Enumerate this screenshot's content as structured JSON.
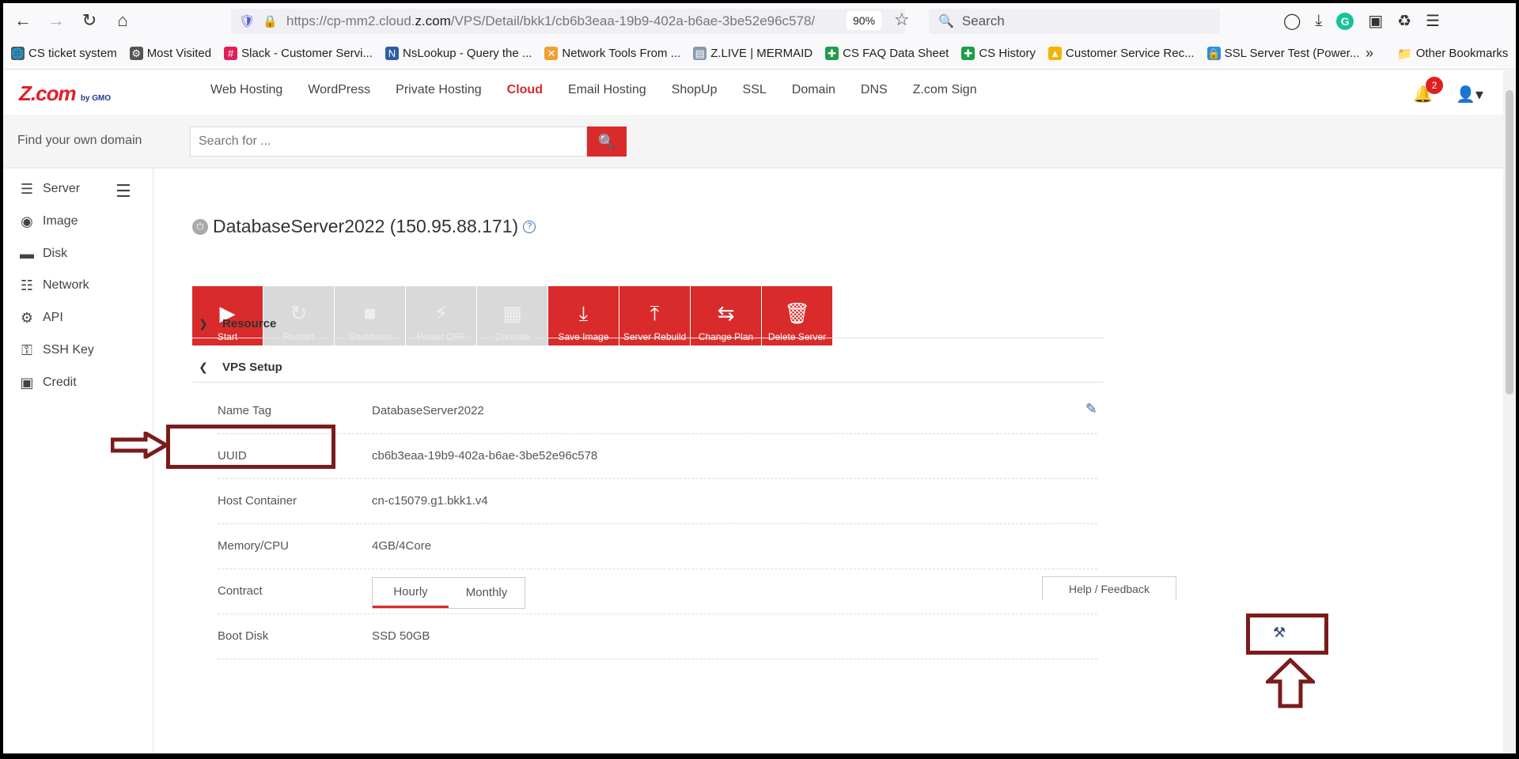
{
  "browser": {
    "url_prefix": "https://cp-mm2.cloud.",
    "url_domain": "z.com",
    "url_path": "/VPS/Detail/bkk1/cb6b3eaa-19b9-402a-b6ae-3be52e96c578/",
    "zoom": "90%",
    "search_placeholder": "Search",
    "bookmarks": [
      {
        "label": "CS ticket system",
        "icon": "globe-icon",
        "color": "#555555"
      },
      {
        "label": "Most Visited",
        "icon": "gear-icon",
        "color": "#555555"
      },
      {
        "label": "Slack - Customer Servi...",
        "icon": "slack-icon",
        "color": "#e01e5a"
      },
      {
        "label": "NsLookup - Query the ...",
        "icon": "nslookup-icon",
        "color": "#2b5ea7"
      },
      {
        "label": "Network Tools From ...",
        "icon": "network-tools-icon",
        "color": "#f0a030"
      },
      {
        "label": "Z.LIVE | MERMAID",
        "icon": "doc-icon",
        "color": "#8899aa"
      },
      {
        "label": "CS FAQ Data Sheet",
        "icon": "sheets-icon",
        "color": "#1e9e4a"
      },
      {
        "label": "CS History",
        "icon": "sheets-icon",
        "color": "#1e9e4a"
      },
      {
        "label": "Customer Service Rec...",
        "icon": "drive-icon",
        "color": "#f4b400"
      },
      {
        "label": "SSL Server Test (Power...",
        "icon": "lock-icon",
        "color": "#2a8ee0"
      }
    ],
    "bookmarks_more": "»",
    "other_bookmarks": "Other Bookmarks"
  },
  "header": {
    "logo_main": "Z.com",
    "logo_sub": "by GMO",
    "nav": [
      {
        "label": "Web Hosting",
        "active": false
      },
      {
        "label": "WordPress",
        "active": false
      },
      {
        "label": "Private Hosting",
        "active": false
      },
      {
        "label": "Cloud",
        "active": true
      },
      {
        "label": "Email Hosting",
        "active": false
      },
      {
        "label": "ShopUp",
        "active": false
      },
      {
        "label": "SSL",
        "active": false
      },
      {
        "label": "Domain",
        "active": false
      },
      {
        "label": "DNS",
        "active": false
      },
      {
        "label": "Z.com Sign",
        "active": false
      }
    ],
    "notification_count": "2"
  },
  "domain_search": {
    "label": "Find your own domain",
    "placeholder": "Search for ..."
  },
  "sidebar": {
    "items": [
      {
        "label": "Server",
        "icon": "server-icon"
      },
      {
        "label": "Image",
        "icon": "image-disc-icon"
      },
      {
        "label": "Disk",
        "icon": "disk-icon"
      },
      {
        "label": "Network",
        "icon": "network-icon"
      },
      {
        "label": "API",
        "icon": "api-icon"
      },
      {
        "label": "SSH Key",
        "icon": "key-icon"
      },
      {
        "label": "Credit",
        "icon": "credit-card-icon"
      }
    ]
  },
  "server": {
    "title": "DatabaseServer2022 (150.95.88.171)",
    "actions": [
      {
        "label": "Start",
        "enabled": true,
        "icon": "play-icon"
      },
      {
        "label": "Restart",
        "enabled": false,
        "icon": "restart-icon"
      },
      {
        "label": "Shutdown",
        "enabled": false,
        "icon": "stop-icon"
      },
      {
        "label": "Power OFF",
        "enabled": false,
        "icon": "plug-icon"
      },
      {
        "label": "Console",
        "enabled": false,
        "icon": "console-icon"
      },
      {
        "label": "Save Image",
        "enabled": true,
        "icon": "save-image-icon"
      },
      {
        "label": "Server Rebuild",
        "enabled": true,
        "icon": "rebuild-icon"
      },
      {
        "label": "Change Plan",
        "enabled": true,
        "icon": "swap-icon"
      },
      {
        "label": "Delete Server",
        "enabled": true,
        "icon": "trash-icon"
      }
    ]
  },
  "sections": {
    "resource": "Resource",
    "vps_setup": "VPS Setup"
  },
  "vps": {
    "name_tag_label": "Name Tag",
    "name_tag": "DatabaseServer2022",
    "uuid_label": "UUID",
    "uuid": "cb6b3eaa-19b9-402a-b6ae-3be52e96c578",
    "host_label": "Host Container",
    "host": "cn-c15079.g1.bkk1.v4",
    "memory_label": "Memory/CPU",
    "memory": "4GB/4Core",
    "contract_label": "Contract",
    "contract_options": [
      "Hourly",
      "Monthly"
    ],
    "contract_selected": "Hourly",
    "boot_label": "Boot Disk",
    "boot": "SSD 50GB"
  },
  "feedback": "Help / Feedback",
  "colors": {
    "brand_red": "#d92b2b",
    "annotation": "#7b1b1b"
  }
}
